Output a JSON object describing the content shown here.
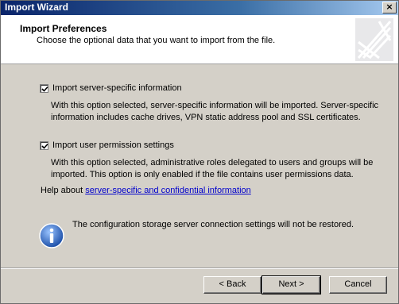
{
  "window": {
    "title": "Import Wizard",
    "close_glyph": "×"
  },
  "header": {
    "title": "Import Preferences",
    "subtitle": "Choose the optional data that you want to import from the file.",
    "logo_icon": "wizard-logo-icon"
  },
  "options": [
    {
      "label": "Import server-specific information",
      "checked": true,
      "description_line1": "With this option selected, server-specific information will be imported. Server-specific",
      "description_line2": "information includes cache drives, VPN static address pool and SSL certificates."
    },
    {
      "label": "Import user permission settings",
      "checked": true,
      "description_line1": "With this option selected, administrative roles delegated to users and groups will be",
      "description_line2": "imported. This option is only enabled if the file contains user permissions data."
    }
  ],
  "help": {
    "prefix": "Help about ",
    "link_text": "server-specific and confidential information"
  },
  "info": {
    "icon": "info-icon",
    "message": "The configuration storage server connection settings will not be restored."
  },
  "buttons": {
    "back": "< Back",
    "next": "Next >",
    "cancel": "Cancel"
  },
  "colors": {
    "titlebar_start": "#0a246a",
    "link": "#0000cc",
    "info_blue": "#2060c0"
  }
}
